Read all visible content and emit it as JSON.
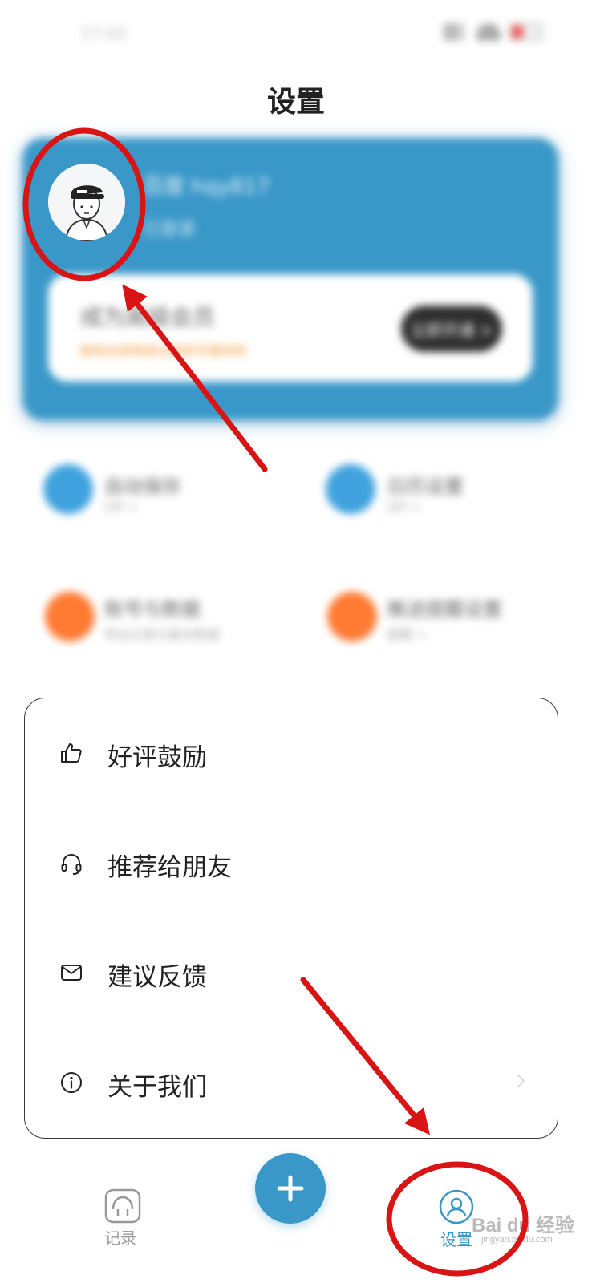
{
  "status_bar": {
    "time": "17:03"
  },
  "header": {
    "title": "设置"
  },
  "profile": {
    "name": "百度 hqy817",
    "subtitle": "已登录",
    "vip_title": "成为高级会员",
    "vip_desc": "解锁全部高级功能和专属特权",
    "vip_button": "立即开通 >"
  },
  "grid": [
    {
      "title": "自动保存",
      "sub": "Off >",
      "color": "#3fa2de"
    },
    {
      "title": "日历设置",
      "sub": "Off >",
      "color": "#3fa2de"
    },
    {
      "title": "账号与数据",
      "sub": "导出记录与备份数据",
      "color": "#ff7a33"
    },
    {
      "title": "推送提醒设置",
      "sub": "提醒 >",
      "color": "#ff7a33"
    }
  ],
  "menu": {
    "items": [
      {
        "label": "好评鼓励",
        "icon": "thumbs-up-icon"
      },
      {
        "label": "推荐给朋友",
        "icon": "headphones-icon"
      },
      {
        "label": "建议反馈",
        "icon": "mail-icon"
      },
      {
        "label": "关于我们",
        "icon": "info-icon"
      }
    ]
  },
  "bottom_nav": {
    "record_label": "记录",
    "add_label": "+",
    "settings_label": "设置"
  },
  "watermark": {
    "text": "Bai du 经验",
    "url": "jingyan.baidu.com"
  },
  "colors": {
    "accent": "#3a98c9",
    "orange": "#ff7a33",
    "annotation": "#d81414"
  }
}
